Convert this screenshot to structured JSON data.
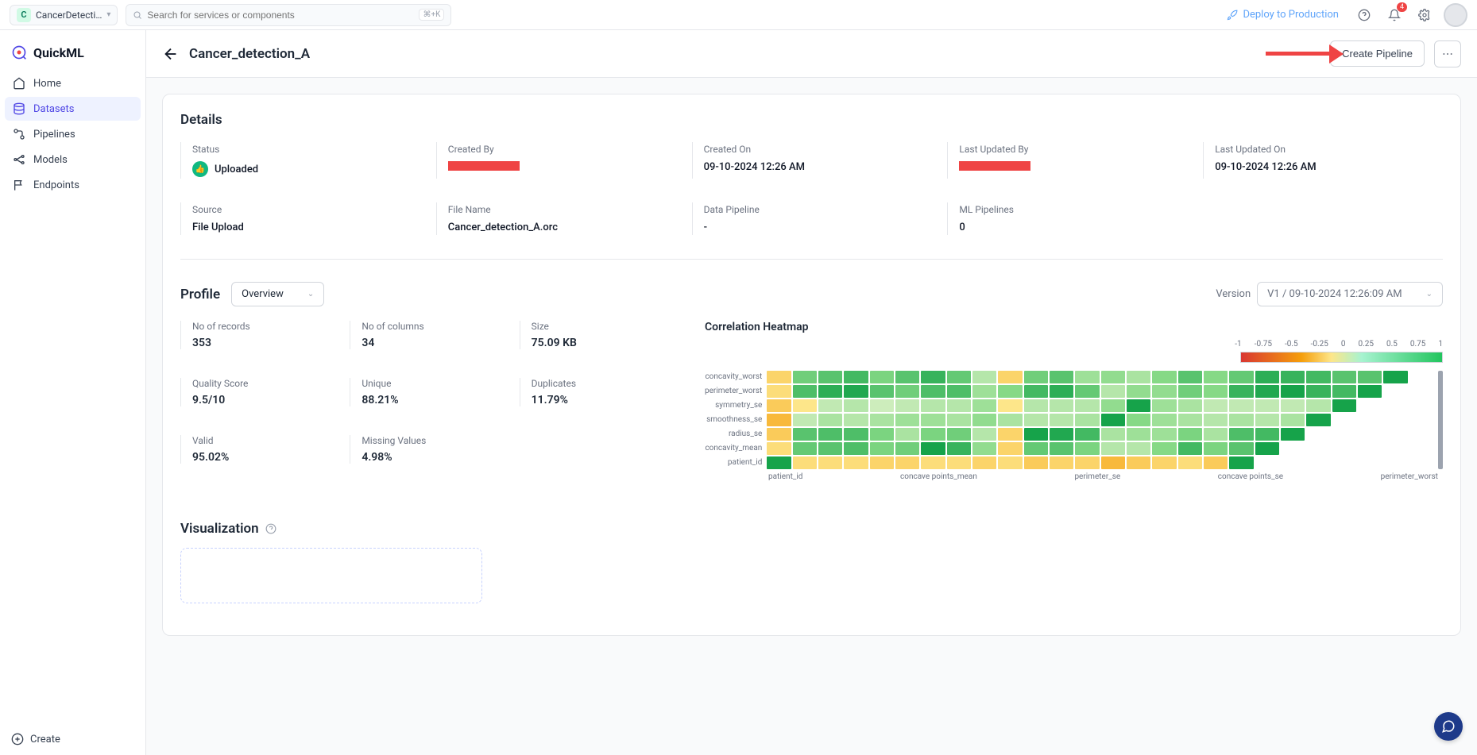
{
  "topbar": {
    "project_name": "CancerDetecti…",
    "project_letter": "C",
    "search_placeholder": "Search for services or components",
    "kbd_hint": "⌘+K",
    "deploy_label": "Deploy to Production",
    "notif_count": "4"
  },
  "sidebar": {
    "brand": "QuickML",
    "items": [
      {
        "label": "Home"
      },
      {
        "label": "Datasets"
      },
      {
        "label": "Pipelines"
      },
      {
        "label": "Models"
      },
      {
        "label": "Endpoints"
      }
    ],
    "create_label": "Create"
  },
  "header": {
    "title": "Cancer_detection_A",
    "create_pipeline_label": "Create Pipeline"
  },
  "details": {
    "section_title": "Details",
    "row1": [
      {
        "label": "Status",
        "value": "Uploaded",
        "status": true
      },
      {
        "label": "Created By",
        "redacted": true
      },
      {
        "label": "Created On",
        "value": "09-10-2024 12:26 AM"
      },
      {
        "label": "Last Updated By",
        "redacted": true
      },
      {
        "label": "Last Updated On",
        "value": "09-10-2024 12:26 AM"
      }
    ],
    "row2": [
      {
        "label": "Source",
        "value": "File Upload"
      },
      {
        "label": "File Name",
        "value": "Cancer_detection_A.orc"
      },
      {
        "label": "Data Pipeline",
        "value": "-"
      },
      {
        "label": "ML Pipelines",
        "value": "0"
      }
    ]
  },
  "profile": {
    "section_title": "Profile",
    "view_label": "Overview",
    "version_prefix": "Version",
    "version_value": "V1 / 09-10-2024 12:26:09 AM",
    "stats": [
      {
        "label": "No of records",
        "value": "353"
      },
      {
        "label": "No of columns",
        "value": "34"
      },
      {
        "label": "Size",
        "value": "75.09 KB"
      },
      {
        "label": "Quality Score",
        "value": "9.5/10"
      },
      {
        "label": "Unique",
        "value": "88.21%"
      },
      {
        "label": "Duplicates",
        "value": "11.79%"
      },
      {
        "label": "Valid",
        "value": "95.02%"
      },
      {
        "label": "Missing Values",
        "value": "4.98%"
      }
    ]
  },
  "chart_data": {
    "type": "heatmap",
    "title": "Correlation Heatmap",
    "legend_ticks": [
      "-1",
      "-0.75",
      "-0.5",
      "-0.25",
      "0",
      "0.25",
      "0.5",
      "0.75",
      "1"
    ],
    "color_scale": {
      "min": -1,
      "max": 1,
      "low_color": "#d93732",
      "mid_color": "#fde68a",
      "high_color": "#16a34a"
    },
    "y_labels": [
      "concavity_worst",
      "perimeter_worst",
      "symmetry_se",
      "smoothness_se",
      "radius_se",
      "concavity_mean",
      "patient_id"
    ],
    "x_labels": [
      "patient_id",
      "concave points_mean",
      "perimeter_se",
      "concave points_se",
      "perimeter_worst"
    ],
    "cols": 26,
    "values": [
      [
        0.05,
        0.6,
        0.7,
        0.8,
        0.55,
        0.7,
        0.85,
        0.65,
        0.3,
        0.05,
        0.6,
        0.7,
        0.4,
        0.45,
        0.35,
        0.5,
        0.7,
        0.5,
        0.65,
        0.9,
        0.85,
        0.8,
        0.7,
        0.7,
        1.0,
        null
      ],
      [
        0.1,
        0.75,
        0.9,
        0.95,
        0.7,
        0.6,
        0.75,
        0.75,
        0.4,
        0.5,
        0.8,
        0.9,
        0.65,
        0.3,
        0.45,
        0.45,
        0.6,
        0.5,
        0.85,
        0.95,
        1.0,
        0.85,
        0.8,
        1.0,
        null,
        null
      ],
      [
        0.0,
        0.15,
        0.25,
        0.3,
        0.2,
        0.25,
        0.3,
        0.3,
        0.4,
        0.15,
        0.3,
        0.3,
        0.3,
        0.45,
        1.0,
        0.4,
        0.35,
        0.25,
        0.25,
        0.25,
        0.25,
        0.3,
        1.0,
        null,
        null,
        null
      ],
      [
        -0.1,
        0.25,
        0.35,
        0.3,
        0.35,
        0.4,
        0.4,
        0.35,
        0.45,
        0.35,
        0.3,
        0.3,
        0.35,
        1.0,
        0.5,
        0.4,
        0.35,
        0.3,
        0.35,
        0.3,
        0.35,
        1.0,
        null,
        null,
        null,
        null
      ],
      [
        0.0,
        0.7,
        0.75,
        0.75,
        0.55,
        0.35,
        0.55,
        0.6,
        0.3,
        0.05,
        1.0,
        0.95,
        0.8,
        0.35,
        0.4,
        0.4,
        0.55,
        0.35,
        0.75,
        0.8,
        1.0,
        null,
        null,
        null,
        null,
        null
      ],
      [
        0.1,
        0.65,
        0.7,
        0.75,
        0.55,
        0.6,
        1.0,
        0.85,
        0.45,
        0.05,
        0.65,
        0.7,
        0.55,
        0.3,
        0.3,
        0.5,
        0.8,
        0.55,
        0.7,
        1.0,
        null,
        null,
        null,
        null,
        null,
        null
      ],
      [
        1.0,
        0.1,
        0.1,
        0.1,
        0.05,
        0.05,
        0.1,
        0.1,
        0.05,
        0.1,
        0.0,
        0.05,
        0.05,
        -0.1,
        0.0,
        0.05,
        0.1,
        0.0,
        1.0,
        null,
        null,
        null,
        null,
        null,
        null,
        null
      ]
    ]
  },
  "visualization": {
    "section_title": "Visualization"
  }
}
